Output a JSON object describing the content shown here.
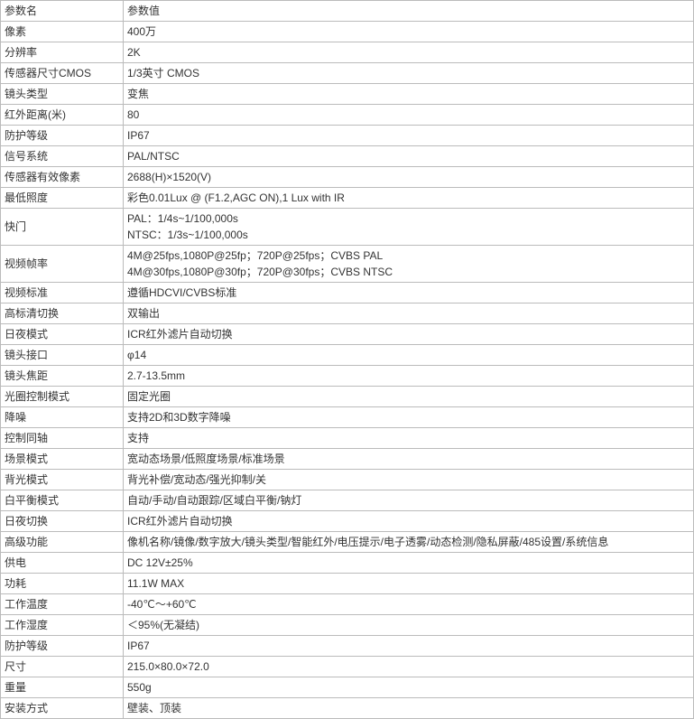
{
  "header": {
    "name_label": "参数名",
    "value_label": "参数值"
  },
  "rows": [
    {
      "name": "像素",
      "value": "400万"
    },
    {
      "name": "分辨率",
      "value": "2K"
    },
    {
      "name": "传感器尺寸CMOS",
      "value": "1/3英寸 CMOS"
    },
    {
      "name": "镜头类型",
      "value": "变焦"
    },
    {
      "name": "红外距离(米)",
      "value": "80"
    },
    {
      "name": "防护等级",
      "value": "IP67"
    },
    {
      "name": "信号系统",
      "value": "PAL/NTSC"
    },
    {
      "name": "传感器有效像素",
      "value": "2688(H)×1520(V)"
    },
    {
      "name": "最低照度",
      "value": "彩色0.01Lux @ (F1.2,AGC ON),1 Lux with IR"
    },
    {
      "name": "快门",
      "value": "PAL：1/4s~1/100,000s\nNTSC：1/3s~1/100,000s"
    },
    {
      "name": "视频帧率",
      "value": "4M@25fps,1080P@25fp；720P@25fps；CVBS PAL\n4M@30fps,1080P@30fp；720P@30fps；CVBS NTSC"
    },
    {
      "name": "视频标准",
      "value": "遵循HDCVI/CVBS标准"
    },
    {
      "name": "高标清切换",
      "value": "双输出"
    },
    {
      "name": "日夜模式",
      "value": "ICR红外滤片自动切换"
    },
    {
      "name": "镜头接口",
      "value": "φ14"
    },
    {
      "name": "镜头焦距",
      "value": "2.7-13.5mm"
    },
    {
      "name": "光圈控制模式",
      "value": "固定光圈"
    },
    {
      "name": "降噪",
      "value": "支持2D和3D数字降噪"
    },
    {
      "name": "控制同轴",
      "value": "支持"
    },
    {
      "name": "场景模式",
      "value": "宽动态场景/低照度场景/标准场景"
    },
    {
      "name": "背光模式",
      "value": "背光补偿/宽动态/强光抑制/关"
    },
    {
      "name": "白平衡模式",
      "value": "自动/手动/自动跟踪/区域白平衡/钠灯"
    },
    {
      "name": "日夜切换",
      "value": "ICR红外滤片自动切换"
    },
    {
      "name": "高级功能",
      "value": "像机名称/镜像/数字放大/镜头类型/智能红外/电压提示/电子透雾/动态检测/隐私屏蔽/485设置/系统信息"
    },
    {
      "name": "供电",
      "value": "DC 12V±25%"
    },
    {
      "name": "功耗",
      "value": "11.1W MAX"
    },
    {
      "name": "工作温度",
      "value": "-40℃～+60℃"
    },
    {
      "name": "工作湿度",
      "value": "＜95%(无凝结)"
    },
    {
      "name": "防护等级",
      "value": "IP67"
    },
    {
      "name": "尺寸",
      "value": "215.0×80.0×72.0"
    },
    {
      "name": "重量",
      "value": "550g"
    },
    {
      "name": "安装方式",
      "value": "壁装、顶装"
    }
  ],
  "chart_data": {
    "type": "table",
    "columns": [
      "参数名",
      "参数值"
    ],
    "rows": [
      [
        "像素",
        "400万"
      ],
      [
        "分辨率",
        "2K"
      ],
      [
        "传感器尺寸CMOS",
        "1/3英寸 CMOS"
      ],
      [
        "镜头类型",
        "变焦"
      ],
      [
        "红外距离(米)",
        "80"
      ],
      [
        "防护等级",
        "IP67"
      ],
      [
        "信号系统",
        "PAL/NTSC"
      ],
      [
        "传感器有效像素",
        "2688(H)×1520(V)"
      ],
      [
        "最低照度",
        "彩色0.01Lux @ (F1.2,AGC ON),1 Lux with IR"
      ],
      [
        "快门",
        "PAL：1/4s~1/100,000s\nNTSC：1/3s~1/100,000s"
      ],
      [
        "视频帧率",
        "4M@25fps,1080P@25fp；720P@25fps；CVBS PAL\n4M@30fps,1080P@30fp；720P@30fps；CVBS NTSC"
      ],
      [
        "视频标准",
        "遵循HDCVI/CVBS标准"
      ],
      [
        "高标清切换",
        "双输出"
      ],
      [
        "日夜模式",
        "ICR红外滤片自动切换"
      ],
      [
        "镜头接口",
        "φ14"
      ],
      [
        "镜头焦距",
        "2.7-13.5mm"
      ],
      [
        "光圈控制模式",
        "固定光圈"
      ],
      [
        "降噪",
        "支持2D和3D数字降噪"
      ],
      [
        "控制同轴",
        "支持"
      ],
      [
        "场景模式",
        "宽动态场景/低照度场景/标准场景"
      ],
      [
        "背光模式",
        "背光补偿/宽动态/强光抑制/关"
      ],
      [
        "白平衡模式",
        "自动/手动/自动跟踪/区域白平衡/钠灯"
      ],
      [
        "日夜切换",
        "ICR红外滤片自动切换"
      ],
      [
        "高级功能",
        "像机名称/镜像/数字放大/镜头类型/智能红外/电压提示/电子透雾/动态检测/隐私屏蔽/485设置/系统信息"
      ],
      [
        "供电",
        "DC 12V±25%"
      ],
      [
        "功耗",
        "11.1W MAX"
      ],
      [
        "工作温度",
        "-40℃～+60℃"
      ],
      [
        "工作湿度",
        "＜95%(无凝结)"
      ],
      [
        "防护等级",
        "IP67"
      ],
      [
        "尺寸",
        "215.0×80.0×72.0"
      ],
      [
        "重量",
        "550g"
      ],
      [
        "安装方式",
        "壁装、顶装"
      ]
    ]
  }
}
